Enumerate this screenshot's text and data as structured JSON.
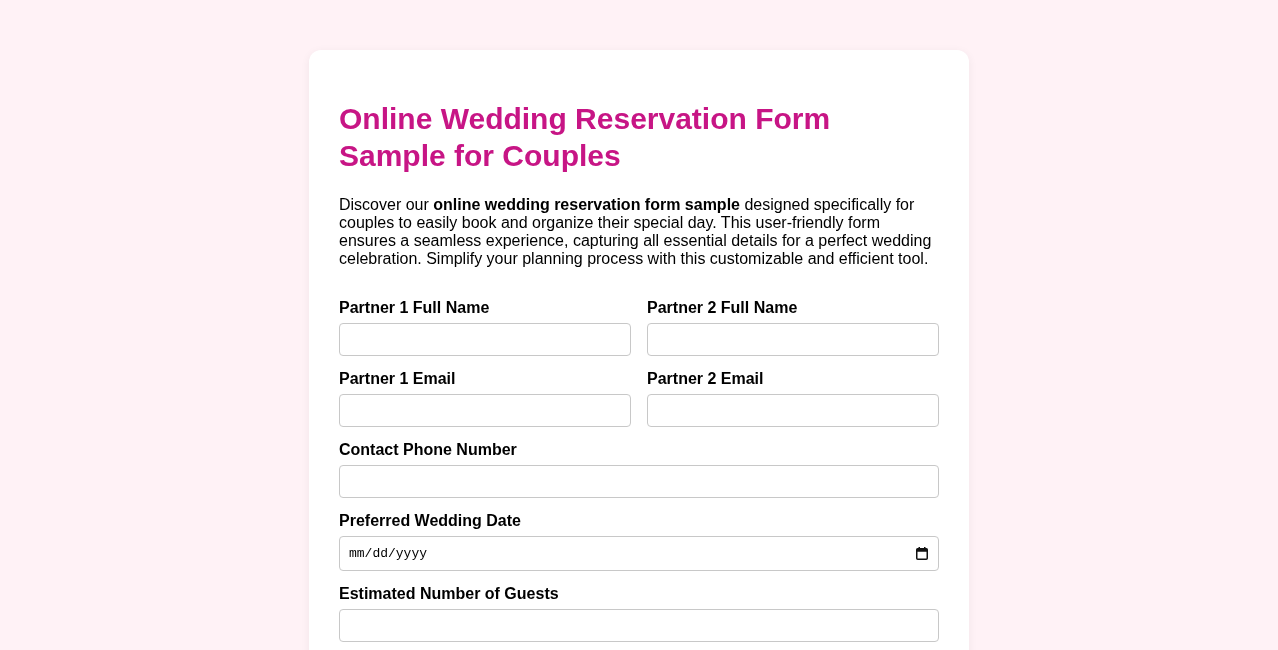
{
  "heading": {
    "title": "Online Wedding Reservation Form Sample for Couples",
    "intro": "Discover our **online wedding reservation form sample** designed specifically for couples to easily book and organize their special day. This user-friendly form ensures a seamless experience, capturing all essential details for a perfect wedding celebration. Simplify your planning process with this customizable and efficient tool."
  },
  "form": {
    "rows": [
      {
        "fields": [
          {
            "label": "Partner 1 Full Name",
            "kind": "text"
          },
          {
            "label": "Partner 2 Full Name",
            "kind": "text"
          }
        ]
      },
      {
        "fields": [
          {
            "label": "Partner 1 Email",
            "kind": "email"
          },
          {
            "label": "Partner 2 Email",
            "kind": "email"
          }
        ]
      },
      {
        "fields": [
          {
            "label": "Contact Phone Number",
            "kind": "tel"
          }
        ]
      },
      {
        "fields": [
          {
            "label": "Preferred Wedding Date",
            "kind": "date",
            "placeholder": "mm/dd/yyyy"
          }
        ]
      },
      {
        "fields": [
          {
            "label": "Estimated Number of Guests",
            "kind": "number"
          }
        ]
      }
    ]
  }
}
